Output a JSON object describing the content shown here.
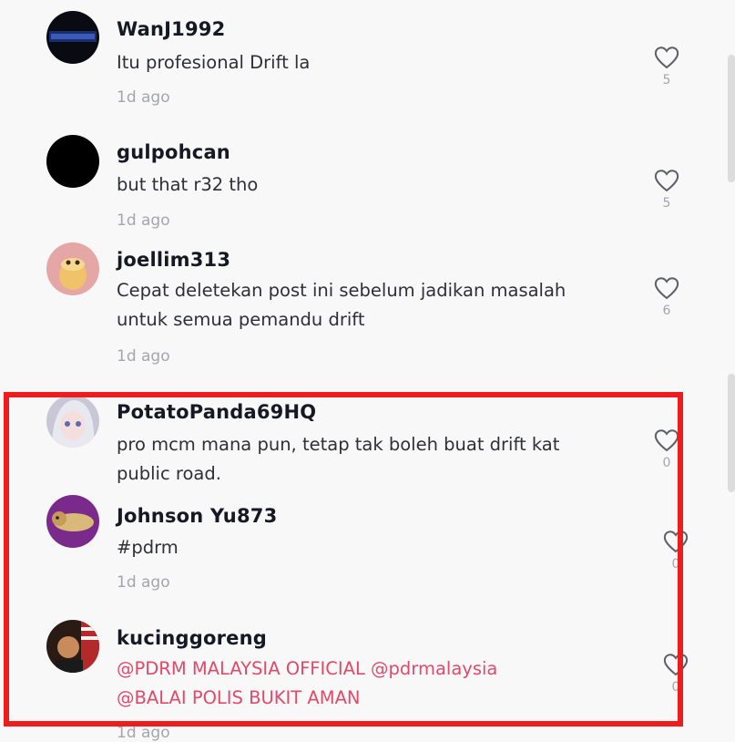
{
  "colors": {
    "background": "#f8f8f8",
    "mention": "#e04a6b",
    "highlight_border": "#ee1c1c",
    "meta_text": "#a5a6ab"
  },
  "comments": [
    {
      "username": "WanJ1992",
      "text": "Itu profesional Drift la",
      "time": "1d ago",
      "likes": "5",
      "avatar_icon": "avatar-badge-icon"
    },
    {
      "username": "gulpohcan",
      "text": "but that r32 tho",
      "time": "1d ago",
      "likes": "5",
      "avatar_icon": "avatar-black-icon"
    },
    {
      "username": "joellim313",
      "text": "Cepat deletekan post ini sebelum jadikan masalah untuk semua pemandu drift",
      "time": "1d ago",
      "likes": "6",
      "avatar_icon": "avatar-cartoon-icon"
    },
    {
      "username": "PotatoPanda69HQ",
      "text": "pro mcm mana pun, tetap tak boleh buat drift kat public road.",
      "likes": "0",
      "avatar_icon": "avatar-anime-icon"
    },
    {
      "username": "Johnson Yu873",
      "text": "#pdrm",
      "time": "1d ago",
      "likes": "0",
      "avatar_icon": "avatar-dog-icon"
    },
    {
      "username": "kucinggoreng",
      "mentions": [
        "@PDRM MALAYSIA OFFICIAL",
        "@pdrmalaysia",
        "@BALAI POLIS BUKIT AMAN"
      ],
      "likes": "0",
      "avatar_icon": "avatar-person-flag-icon"
    }
  ],
  "last_partial_time": "1d ago"
}
